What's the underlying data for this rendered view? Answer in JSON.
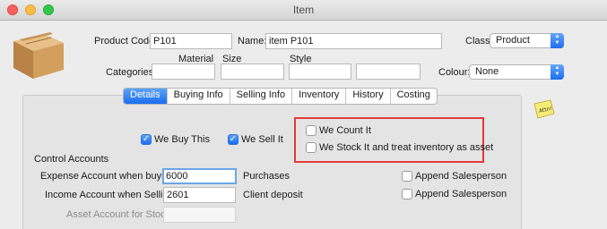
{
  "window": {
    "title": "Item"
  },
  "header": {
    "product_code_label": "Product Code:",
    "product_code_value": "P101",
    "name_label": "Name:",
    "name_value": "item P101",
    "class_label": "Class:",
    "class_value": "Product",
    "categories_label": "Categories:",
    "category_headers": [
      "Material",
      "Size",
      "Style"
    ],
    "colour_label": "Colour:",
    "colour_value": "None"
  },
  "tabs": [
    {
      "label": "Details",
      "active": true
    },
    {
      "label": "Buying Info",
      "active": false
    },
    {
      "label": "Selling Info",
      "active": false
    },
    {
      "label": "Inventory",
      "active": false
    },
    {
      "label": "History",
      "active": false
    },
    {
      "label": "Costing",
      "active": false
    }
  ],
  "details": {
    "we_buy_this_label": "We Buy This",
    "we_buy_this_checked": true,
    "we_sell_it_label": "We Sell It",
    "we_sell_it_checked": true,
    "we_count_it_label": "We Count It",
    "we_count_it_checked": false,
    "we_stock_it_label": "We Stock It and treat inventory as asset",
    "we_stock_it_checked": false,
    "control_accounts_label": "Control Accounts",
    "expense_label": "Expense Account when buying:",
    "expense_value": "6000",
    "expense_name": "Purchases",
    "income_label": "Income Account when Selling:",
    "income_value": "2601",
    "income_name": "Client deposit",
    "asset_label": "Asset Account for Stock:",
    "asset_value": "",
    "append_salesperson_1": "Append Salesperson",
    "append_salesperson_2": "Append Salesperson"
  },
  "note_icon_label": "Attn!",
  "colors": {
    "highlight_box": "#e23b3b",
    "accent": "#1c6df0"
  },
  "icons": [
    "product-box-icon",
    "sticky-note-icon",
    "checkmark-icon",
    "select-arrows-icon"
  ]
}
